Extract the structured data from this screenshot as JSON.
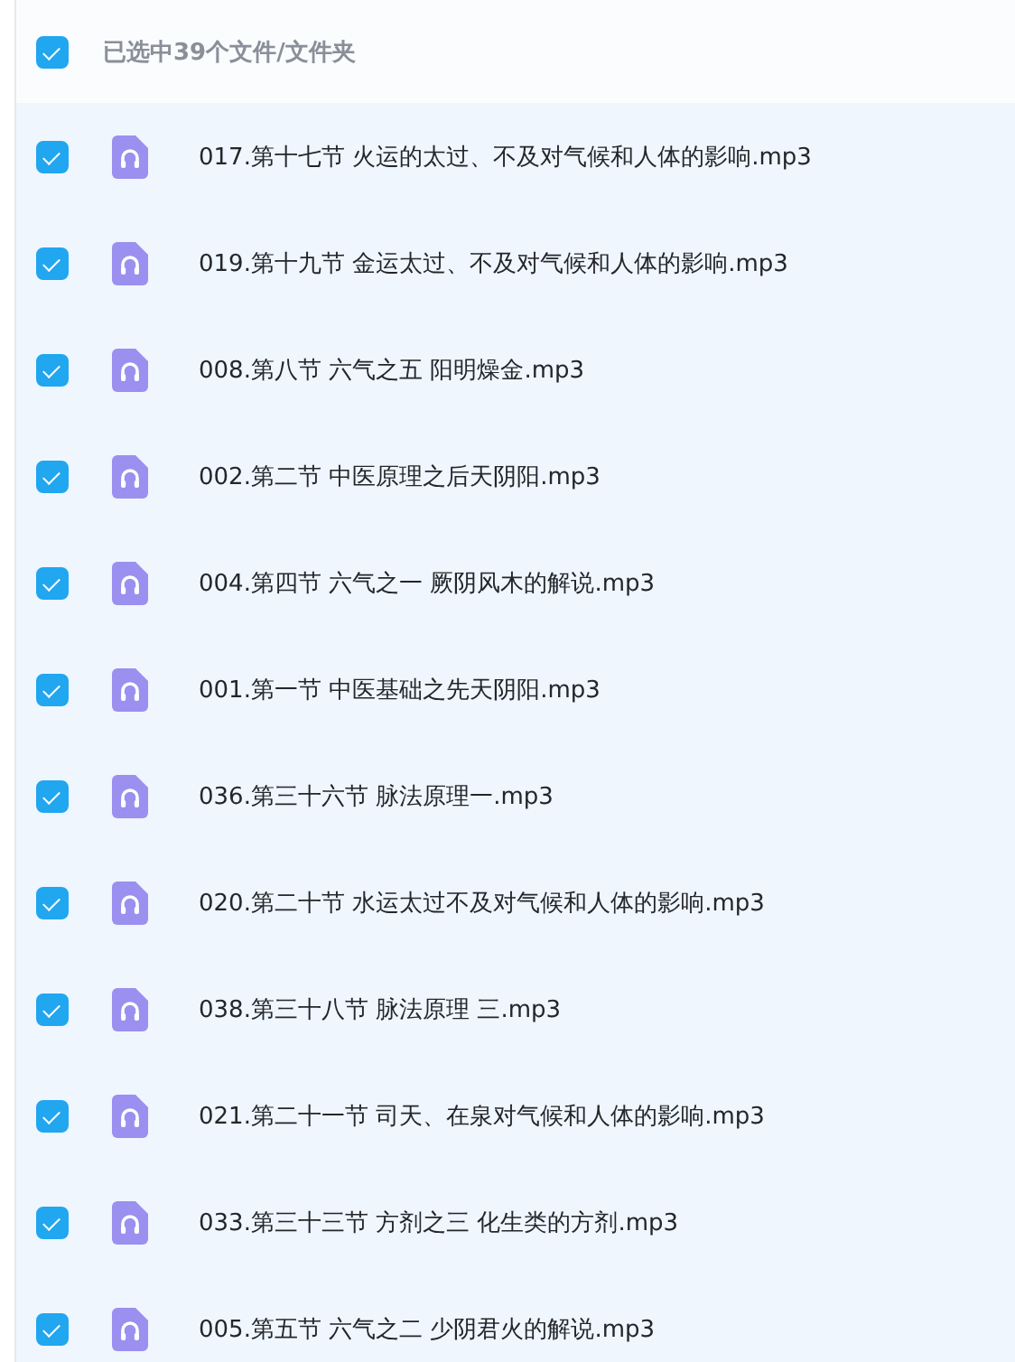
{
  "header": {
    "checked": true,
    "label": "已选中39个文件/文件夹"
  },
  "files": [
    {
      "name": "017.第十七节 火运的太过、不及对气候和人体的影响.mp3",
      "checked": true
    },
    {
      "name": "019.第十九节 金运太过、不及对气候和人体的影响.mp3",
      "checked": true
    },
    {
      "name": "008.第八节 六气之五 阳明燥金.mp3",
      "checked": true
    },
    {
      "name": "002.第二节 中医原理之后天阴阳.mp3",
      "checked": true
    },
    {
      "name": "004.第四节 六气之一 厥阴风木的解说.mp3",
      "checked": true
    },
    {
      "name": "001.第一节 中医基础之先天阴阳.mp3",
      "checked": true
    },
    {
      "name": "036.第三十六节 脉法原理一.mp3",
      "checked": true
    },
    {
      "name": "020.第二十节 水运太过不及对气候和人体的影响.mp3",
      "checked": true
    },
    {
      "name": "038.第三十八节 脉法原理 三.mp3",
      "checked": true
    },
    {
      "name": "021.第二十一节 司天、在泉对气候和人体的影响.mp3",
      "checked": true
    },
    {
      "name": "033.第三十三节 方剂之三 化生类的方剂.mp3",
      "checked": true
    },
    {
      "name": "005.第五节 六气之二 少阴君火的解说.mp3",
      "checked": true
    }
  ]
}
